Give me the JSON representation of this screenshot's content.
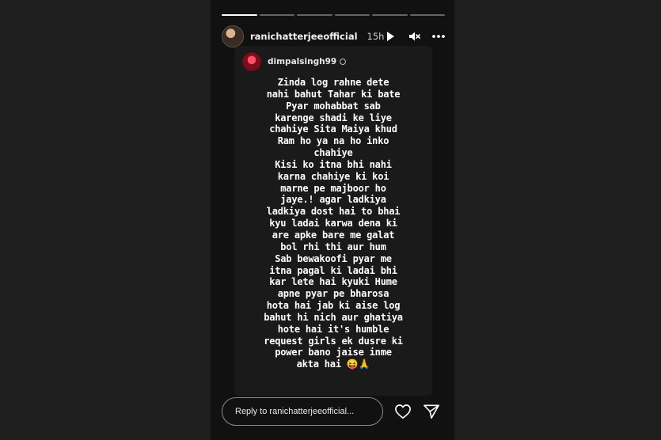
{
  "story": {
    "progress_segments": 6,
    "active_segment": 0,
    "header": {
      "username": "ranichatterjeeofficial",
      "time": "15h",
      "icons": [
        "play-icon",
        "mute-icon",
        "more-icon"
      ]
    },
    "shared_post": {
      "username": "dimpalsingh99",
      "text": "Zinda log rahne dete\nnahi bahut Tahar ki bate\nPyar mohabbat sab\nkarenge shadi ke liye\nchahiye Sita Maiya khud\nRam ho ya na ho inko\nchahiye\nKisi ko itna bhi nahi\nkarna chahiye ki koi\nmarne pe majboor ho\njaye.! agar ladkiya\nladkiya dost hai to bhai\nkyu ladai karwa dena ki\nare apke bare me galat\nbol rhi thi aur hum\nSab bewakoofi pyar me\nitna pagal ki ladai bhi\nkar lete hai kyuki Hume\napne pyar pe bharosa\nhota hai jab ki aise log\nbahut hi nich aur ghatiya\nhote hai it's humble\nrequest girls ek dusre ki\npower bano jaise inme\nakta hai 😝🙏"
    },
    "reply": {
      "placeholder": "Reply to ranichatterjeeofficial...",
      "icons": [
        "heart-icon",
        "send-icon"
      ]
    }
  }
}
